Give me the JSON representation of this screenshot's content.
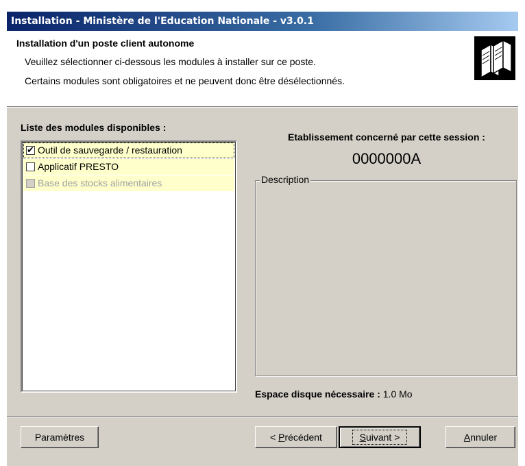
{
  "window": {
    "title": "Installation - Ministère de l'Education Nationale - v3.0.1"
  },
  "header": {
    "title": "Installation d'un poste client autonome",
    "line1": "Veuillez sélectionner ci-dessous les modules à installer sur ce poste.",
    "line2": "Certains modules sont obligatoires et ne peuvent donc être désélectionnés.",
    "icon": "servers-icon"
  },
  "modules": {
    "label": "Liste des modules disponibles :",
    "items": [
      {
        "label": "Outil de sauvegarde / restauration",
        "checked": true,
        "enabled": true
      },
      {
        "label": "Applicatif PRESTO",
        "checked": false,
        "enabled": true
      },
      {
        "label": "Base des stocks alimentaires",
        "checked": false,
        "enabled": false
      }
    ]
  },
  "establishment": {
    "label": "Etablissement concerné par cette session :",
    "code": "0000000A"
  },
  "description": {
    "legend": "Description"
  },
  "disk": {
    "label": "Espace disque nécessaire :",
    "value": "1.0 Mo"
  },
  "buttons": {
    "params": "Paramètres",
    "prev_prefix": "< ",
    "prev_mnemonic": "P",
    "prev_rest": "récédent",
    "next_mnemonic": "S",
    "next_rest": "uivant >",
    "cancel_mnemonic": "A",
    "cancel_rest": "nnuler"
  },
  "colors": {
    "titlebar": "#0a246a",
    "dialog": "#d4d0c8",
    "list_highlight": "#ffffcc"
  }
}
